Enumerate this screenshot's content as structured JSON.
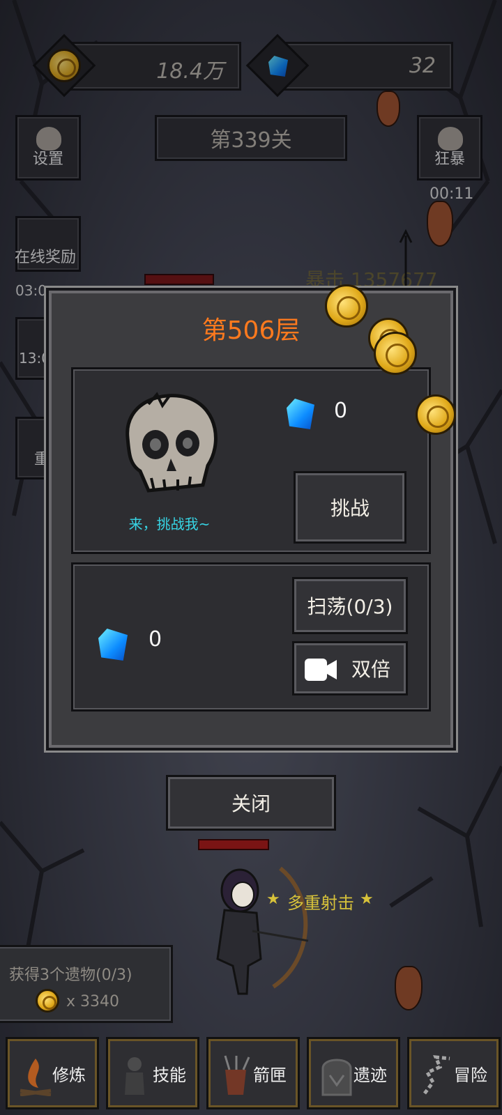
{
  "header": {
    "gold_amount": "18.4万",
    "gem_amount": "32",
    "stage_label": "第339关"
  },
  "side_left": {
    "settings_label": "设置",
    "online_reward_label": "在线奖励",
    "online_timer": "03:0",
    "row2_timer": "13:0",
    "row3_label": "重"
  },
  "side_right": {
    "rage_label": "狂暴",
    "rage_timer": "00:11"
  },
  "battle": {
    "crit_text": "暴击 1357677",
    "skill_text": "多重射击"
  },
  "modal": {
    "title": "第506层",
    "reward_gem_value": "0",
    "challenge_label": "挑战",
    "boss_taunt": "来，挑战我~",
    "sweep_label": "扫荡(0/3)",
    "double_label": "双倍",
    "sweep_gem_value": "0"
  },
  "close_label": "关闭",
  "quest": {
    "text": "获得3个遗物(0/3)",
    "reward": "x 3340"
  },
  "nav": {
    "items": [
      {
        "label": "修炼",
        "icon": "campfire-icon"
      },
      {
        "label": "技能",
        "icon": "hero-icon"
      },
      {
        "label": "箭匣",
        "icon": "quiver-icon"
      },
      {
        "label": "遗迹",
        "icon": "ruins-icon"
      },
      {
        "label": "冒险",
        "icon": "map-path-icon"
      }
    ]
  },
  "colors": {
    "title_orange": "#ff7a1e",
    "taunt_cyan": "#37d6e6",
    "skill_yellow": "#d7c23a"
  }
}
